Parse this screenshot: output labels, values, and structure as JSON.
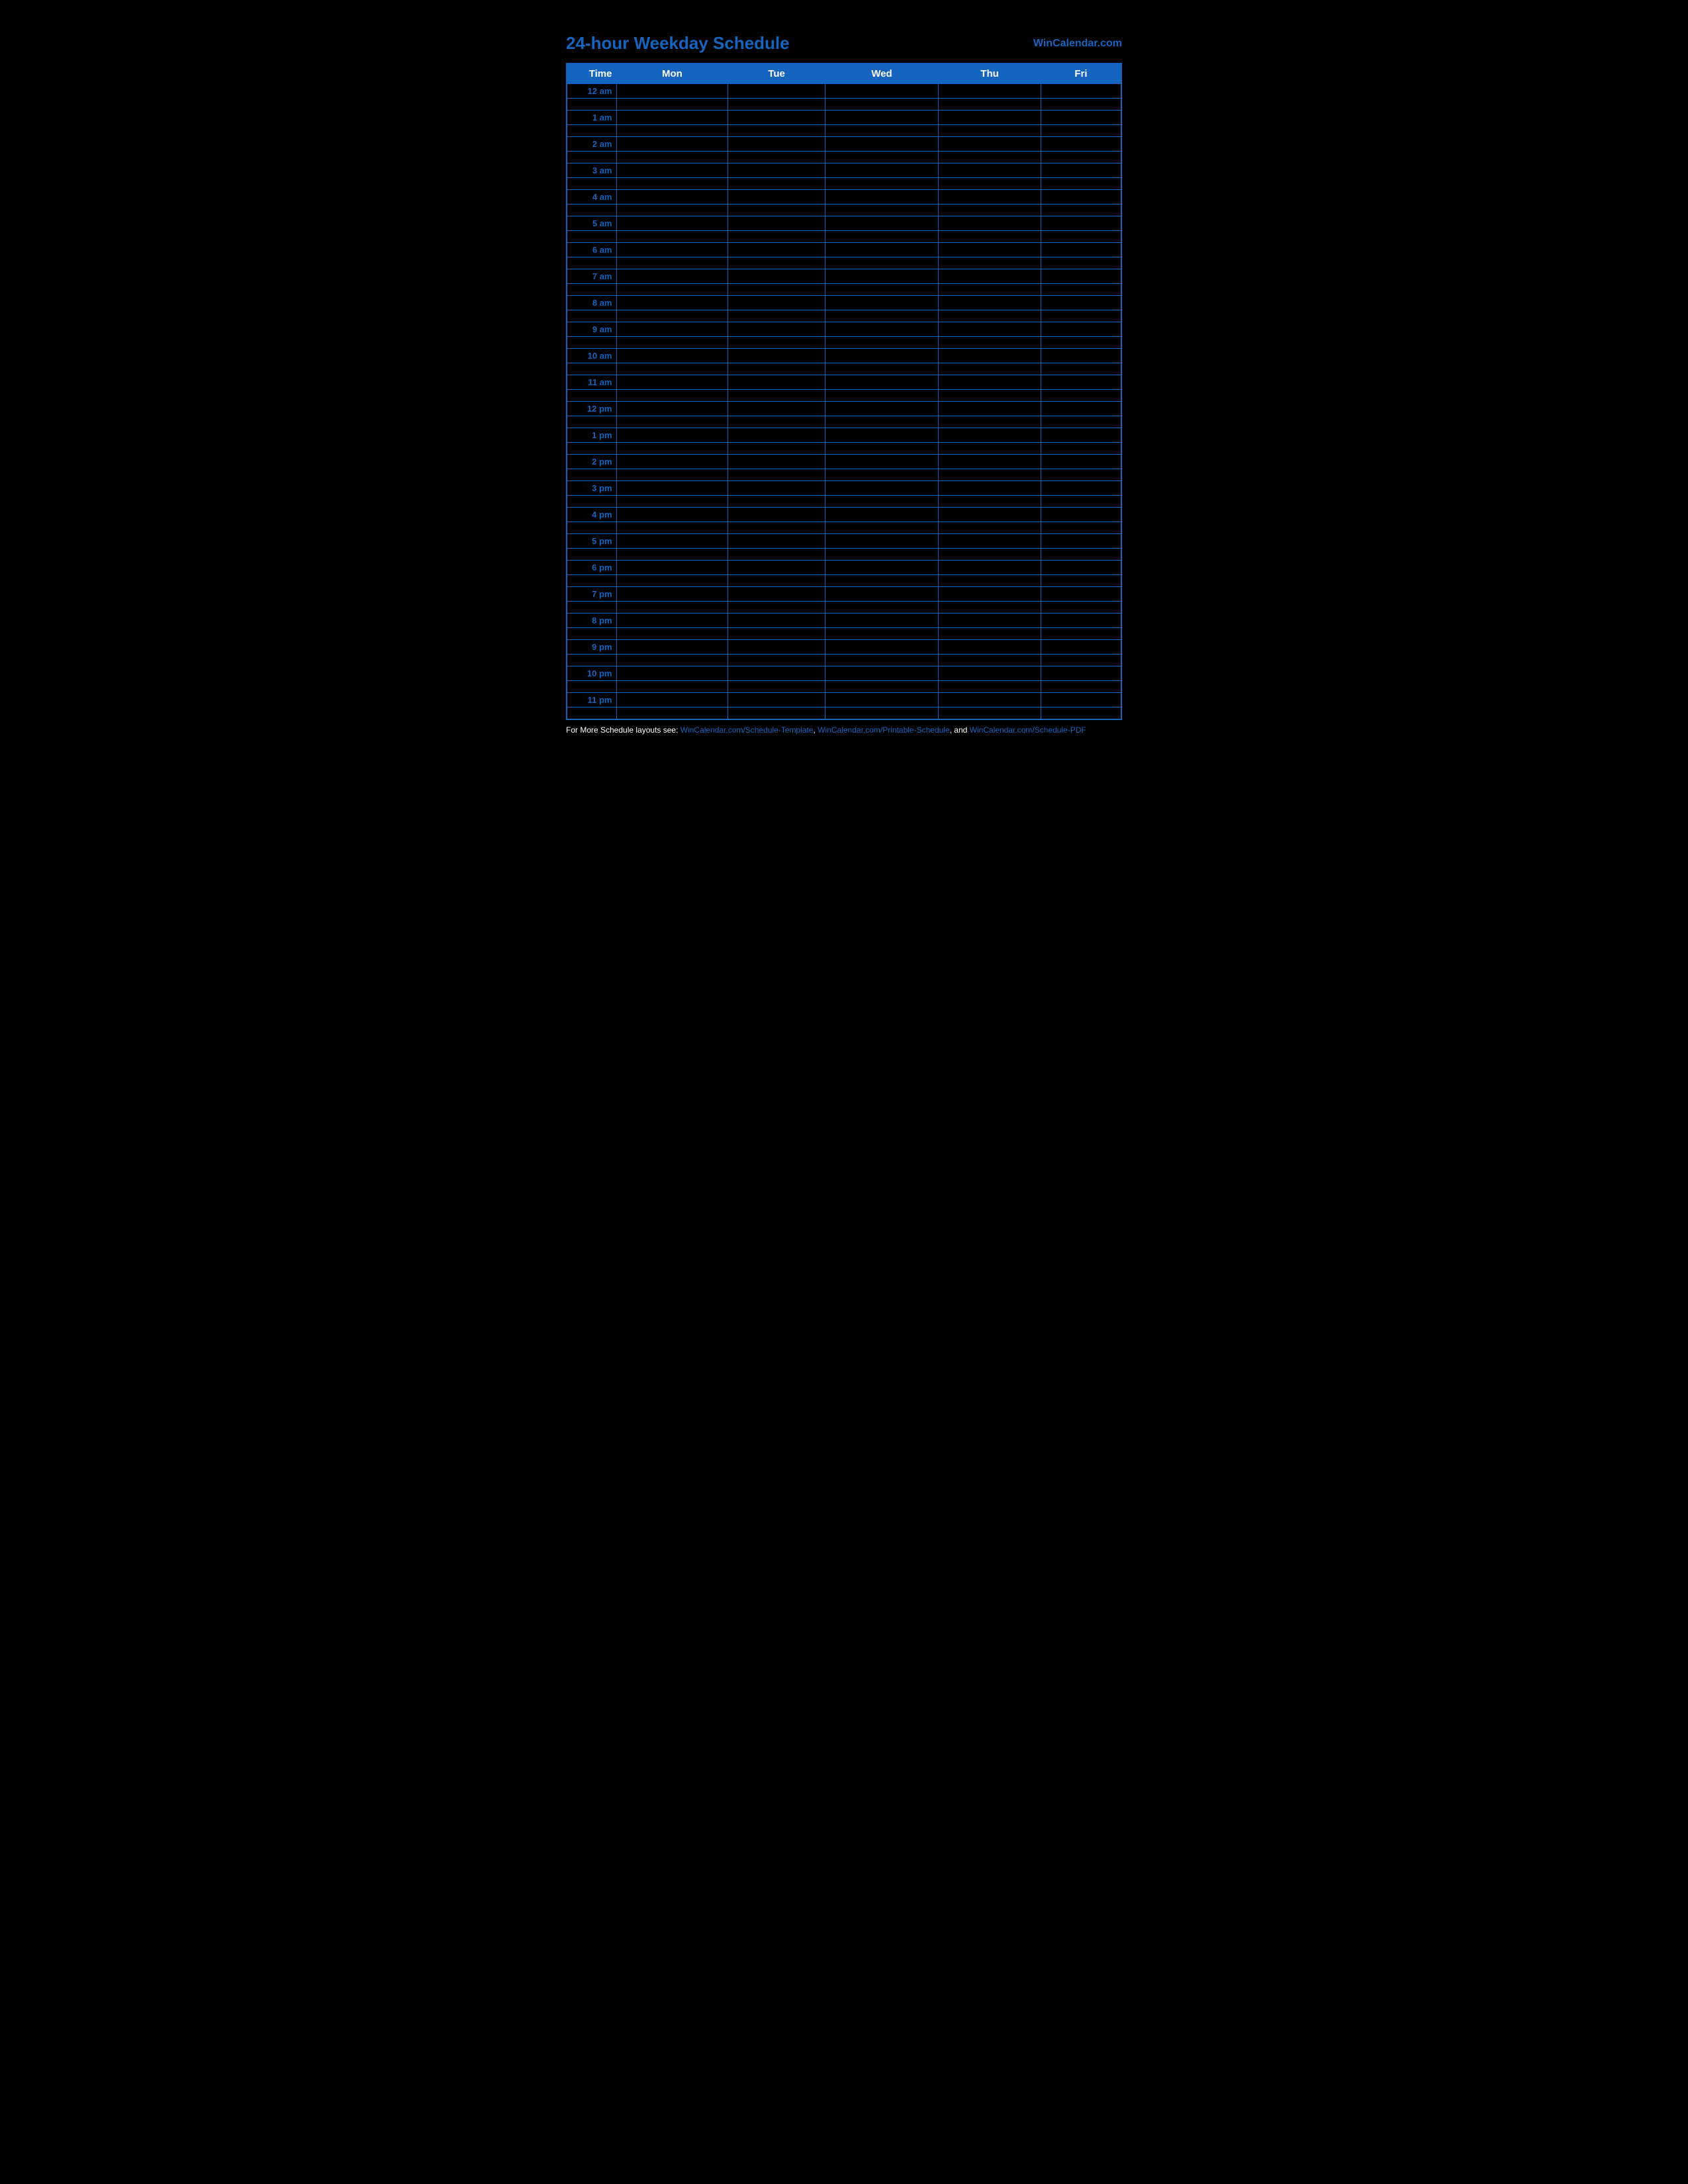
{
  "header": {
    "title": "24-hour Weekday Schedule",
    "site": "WinCalendar.com"
  },
  "table": {
    "headers": [
      "Time",
      "Mon",
      "Tue",
      "Wed",
      "Thu",
      "Fri"
    ],
    "hours": [
      "12 am",
      "1 am",
      "2 am",
      "3 am",
      "4 am",
      "5 am",
      "6 am",
      "7 am",
      "8 am",
      "9 am",
      "10 am",
      "11 am",
      "12 pm",
      "1 pm",
      "2 pm",
      "3 pm",
      "4 pm",
      "5 pm",
      "6 pm",
      "7 pm",
      "8 pm",
      "9 pm",
      "10 pm",
      "11 pm"
    ]
  },
  "footer": {
    "text": "For More Schedule layouts see: ",
    "links": [
      {
        "label": "WinCalendar.com/Schedule-Template",
        "url": "#"
      },
      {
        "label": "WinCalendar.com/Printable-Schedule",
        "url": "#"
      },
      {
        "label": "WinCalendar.com/Schedule-PDF",
        "url": "#"
      }
    ]
  }
}
